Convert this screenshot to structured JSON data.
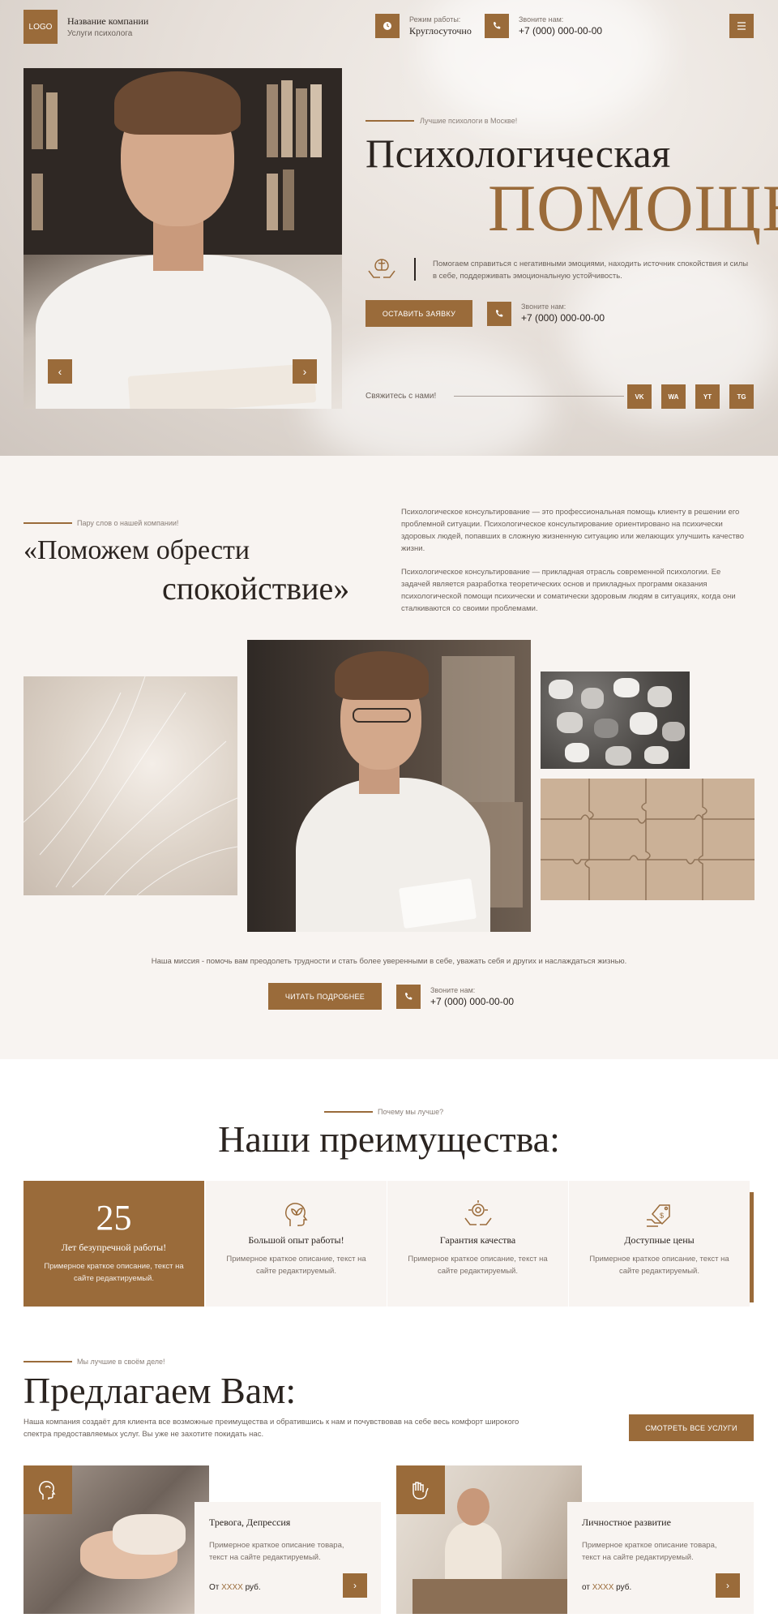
{
  "header": {
    "logo": "LOGO",
    "company_name": "Название компании",
    "company_sub": "Услуги психолога",
    "hours_label": "Режим работы:",
    "hours_value": "Круглосуточно",
    "phone_label": "Звоните нам:",
    "phone_value": "+7 (000) 000-00-00",
    "menu_icon": "hamburger-icon"
  },
  "hero": {
    "tagline": "Лучшие психологи в Москве!",
    "title_line1": "Психологическая",
    "title_line2": "ПОМОЩЬ",
    "description": "Помогаем справиться с негативными эмоциями, находить источник спокойствия и силы в себе, поддерживать эмоциональную устойчивость.",
    "cta_label": "ОСТАВИТЬ ЗАЯВКУ",
    "phone_label": "Звоните нам:",
    "phone_value": "+7 (000) 000-00-00",
    "contact_text": "Свяжитесь с нами!",
    "socials": [
      "VK",
      "WA",
      "YT",
      "TG"
    ],
    "prev_icon": "chevron-left-icon",
    "next_icon": "chevron-right-icon"
  },
  "about": {
    "tagline": "Пару слов о нашей компании!",
    "title_line1": "«Поможем обрести",
    "title_line2": "спокойствие»",
    "paragraph1": "Психологическое консультирование — это профессиональная помощь клиенту в решении его проблемной ситуации. Психологическое консультирование ориентировано на психически здоровых людей, попавших в сложную жизненную ситуацию или желающих улучшить качество жизни.",
    "paragraph2": "Психологическое консультирование — прикладная отрасль современной психологии. Ее задачей является разработка теоретических основ и прикладных программ оказания психологической помощи психически и соматически здоровым людям в ситуациях, когда они сталкиваются со своими проблемами.",
    "mission": "Наша миссия - помочь вам преодолеть трудности и стать более уверенными в себе, уважать себя и других и наслаждаться жизнью.",
    "read_more_label": "ЧИТАТЬ ПОДРОБНЕЕ",
    "phone_label": "Звоните нам:",
    "phone_value": "+7 (000) 000-00-00"
  },
  "advantages": {
    "tagline": "Почему мы лучше?",
    "title": "Наши преимущества:",
    "items": [
      {
        "number": "25",
        "title": "Лет безупречной работы!",
        "desc": "Примерное краткое описание, текст на сайте редактируемый."
      },
      {
        "title": "Большой опыт работы!",
        "desc": "Примерное краткое описание, текст на сайте редактируемый.",
        "icon": "head-plant-icon"
      },
      {
        "title": "Гарантия качества",
        "desc": "Примерное краткое описание, текст на сайте редактируемый.",
        "icon": "quality-badge-icon"
      },
      {
        "title": "Доступные цены",
        "desc": "Примерное краткое описание, текст на сайте редактируемый.",
        "icon": "price-tag-icon"
      }
    ]
  },
  "offers": {
    "tagline": "Мы лучшие в своём деле!",
    "title": "Предлагаем Вам:",
    "description": "Наша компания создаёт для клиента все возможные преимущества и обратившись  к нам и почувствовав на себе весь комфорт широкого спектра предоставляемых услуг. Вы уже не захотите покидать нас.",
    "all_services_label": "СМОТРЕТЬ ВСЕ УСЛУГИ",
    "items": [
      {
        "title": "Тревога, Депрессия",
        "desc": "Примерное краткое описание товара, текст на сайте редактируемый.",
        "price_prefix": "От",
        "price_value": "XXXX",
        "price_unit": "руб."
      },
      {
        "title": "Личностное развитие",
        "desc": "Примерное краткое описание товара, текст на сайте редактируемый.",
        "price_prefix": "от",
        "price_value": "XXXX",
        "price_unit": "руб."
      }
    ]
  }
}
